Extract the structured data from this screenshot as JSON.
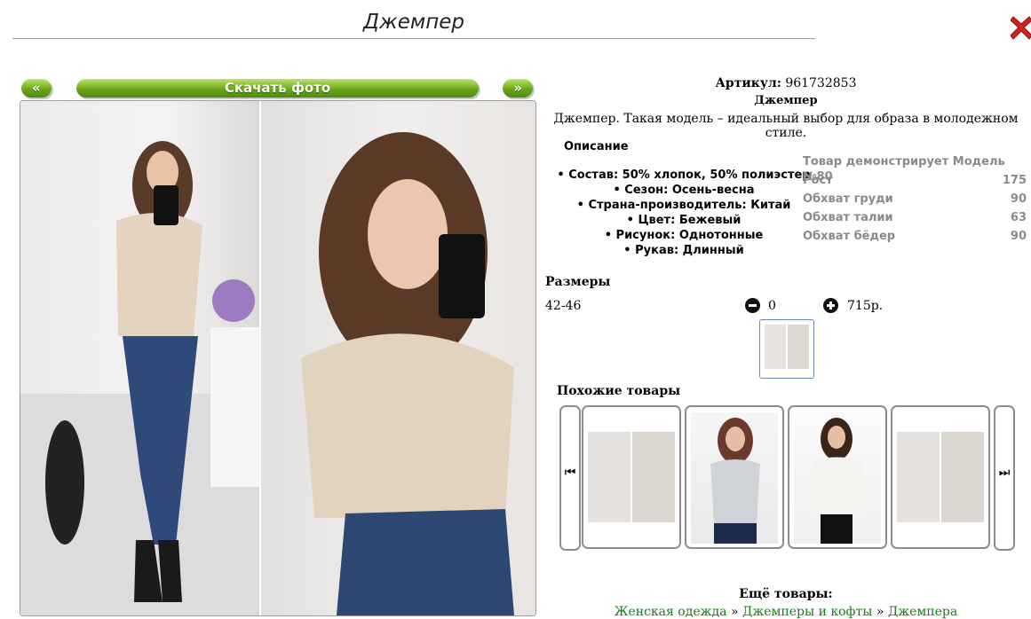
{
  "header": {
    "title": "Джемпер"
  },
  "gallery": {
    "prev_label": "«",
    "next_label": "»",
    "download_label": "Скачать фото"
  },
  "product": {
    "article_label": "Артикул:",
    "article_value": "961732853",
    "name": "Джемпер",
    "description": "Джемпер. Такая модель – идеальный выбор для образа в молодежном стиле."
  },
  "description_section": {
    "title": "Описание",
    "properties": [
      "Состав: 50% хлопок, 50% полиэстер",
      "Сезон: Осень-весна",
      "Страна-производитель: Китай",
      "Цвет: Бежевый",
      "Рисунок: Однотонные",
      "Рукав: Длинный"
    ]
  },
  "model": {
    "rows": [
      {
        "label": "Товар демонстрирует Модель №80",
        "value": ""
      },
      {
        "label": "Рост",
        "value": "175"
      },
      {
        "label": "Обхват груди",
        "value": "90"
      },
      {
        "label": "Обхват талии",
        "value": "63"
      },
      {
        "label": "Обхват бёдер",
        "value": "90"
      }
    ]
  },
  "sizes": {
    "title": "Размеры",
    "rows": [
      {
        "size": "42-46",
        "quantity": "0",
        "price": "715р."
      }
    ]
  },
  "similar": {
    "title": "Похожие товары",
    "prev_icon": "skip-back-icon",
    "next_icon": "skip-forward-icon",
    "prev_glyph": "⏮",
    "next_glyph": "⏭"
  },
  "more": {
    "title": "Ещё товары:",
    "breadcrumbs": [
      "Женская одежда",
      "Джемперы и кофты",
      "Джемпера"
    ],
    "separator": "»"
  },
  "colors": {
    "button_green": "#6aa719",
    "link_green": "#1b7a1b",
    "close_red": "#d61f1f"
  }
}
